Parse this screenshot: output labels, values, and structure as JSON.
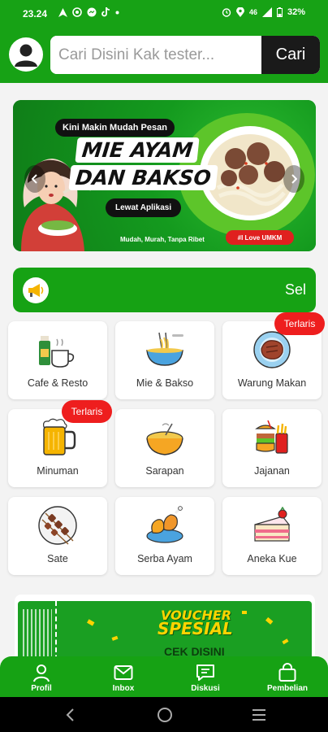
{
  "status_bar": {
    "time": "23.24",
    "signal": "46",
    "battery": "32%"
  },
  "header": {
    "search_placeholder": "Cari Disini Kak tester...",
    "search_button": "Cari"
  },
  "banner": {
    "pill": "Kini Makin Mudah Pesan",
    "title_line1": "MIE AYAM",
    "title_line2": "DAN BAKSO",
    "cta": "Lewat Aplikasi",
    "tagline": "Mudah, Murah, Tanpa Ribet",
    "tag_red": "#I Love UMKM"
  },
  "announcement": {
    "text": "Sel"
  },
  "categories": [
    {
      "label": "Cafe & Resto",
      "icon": "coffee-icon"
    },
    {
      "label": "Mie & Bakso",
      "icon": "noodle-bowl-icon"
    },
    {
      "label": "Warung Makan",
      "icon": "steak-plate-icon",
      "badge": "Terlaris"
    },
    {
      "label": "Minuman",
      "icon": "beer-mug-icon",
      "badge": "Terlaris"
    },
    {
      "label": "Sarapan",
      "icon": "rice-bowl-icon"
    },
    {
      "label": "Jajanan",
      "icon": "snack-icon"
    },
    {
      "label": "Sate",
      "icon": "satay-icon"
    },
    {
      "label": "Serba Ayam",
      "icon": "fried-chicken-icon"
    },
    {
      "label": "Aneka Kue",
      "icon": "cake-icon"
    }
  ],
  "voucher": {
    "title1": "VOUCHER",
    "title2": "SPESIAL",
    "cta": "CEK DISINI"
  },
  "bottom_nav": [
    {
      "label": "Profil",
      "icon": "person-icon"
    },
    {
      "label": "Inbox",
      "icon": "mail-icon"
    },
    {
      "label": "Diskusi",
      "icon": "chat-icon"
    },
    {
      "label": "Pembelian",
      "icon": "shopping-bag-icon"
    }
  ],
  "colors": {
    "primary_green": "#17a215",
    "badge_red": "#ee1e1e",
    "dark": "#1a1a1a"
  }
}
